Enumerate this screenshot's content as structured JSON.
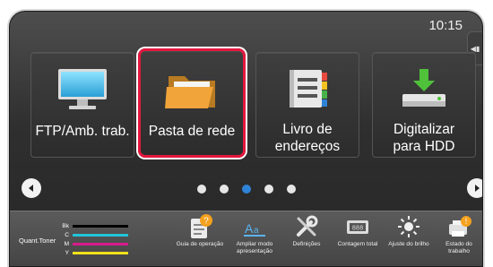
{
  "status": {
    "time": "10:15"
  },
  "tiles": [
    {
      "line1": "FTP/Amb. trab.",
      "line2": "",
      "icon": "monitor-icon"
    },
    {
      "line1": "Pasta de rede",
      "line2": "",
      "icon": "folder-icon"
    },
    {
      "line1": "Livro de",
      "line2": "endereços",
      "icon": "address-book-icon"
    },
    {
      "line1": "Digitalizar",
      "line2": "para HDD",
      "icon": "hdd-download-icon"
    }
  ],
  "pagination": {
    "pages": 5,
    "current": 3
  },
  "toner": {
    "title": "Quant.Toner",
    "levels": [
      {
        "key": "Bk",
        "color": "#000000"
      },
      {
        "key": "C",
        "color": "#21c4d8"
      },
      {
        "key": "M",
        "color": "#d81b8c"
      },
      {
        "key": "Y",
        "color": "#f2e11a"
      }
    ]
  },
  "bottom_items": [
    {
      "label": "Guia de operação",
      "icon": "operation-guide-icon"
    },
    {
      "label": "Ampliar modo apresentação",
      "icon": "enlarge-display-icon"
    },
    {
      "label": "Definições",
      "icon": "settings-tools-icon"
    },
    {
      "label": "Contagem total",
      "icon": "total-count-icon"
    },
    {
      "label": "Ajuste do brilho",
      "icon": "brightness-icon"
    },
    {
      "label": "Estado do trabalho",
      "icon": "job-status-icon"
    }
  ],
  "colors": {
    "selection": "#e3173d",
    "active_dot": "#2f83d6"
  }
}
